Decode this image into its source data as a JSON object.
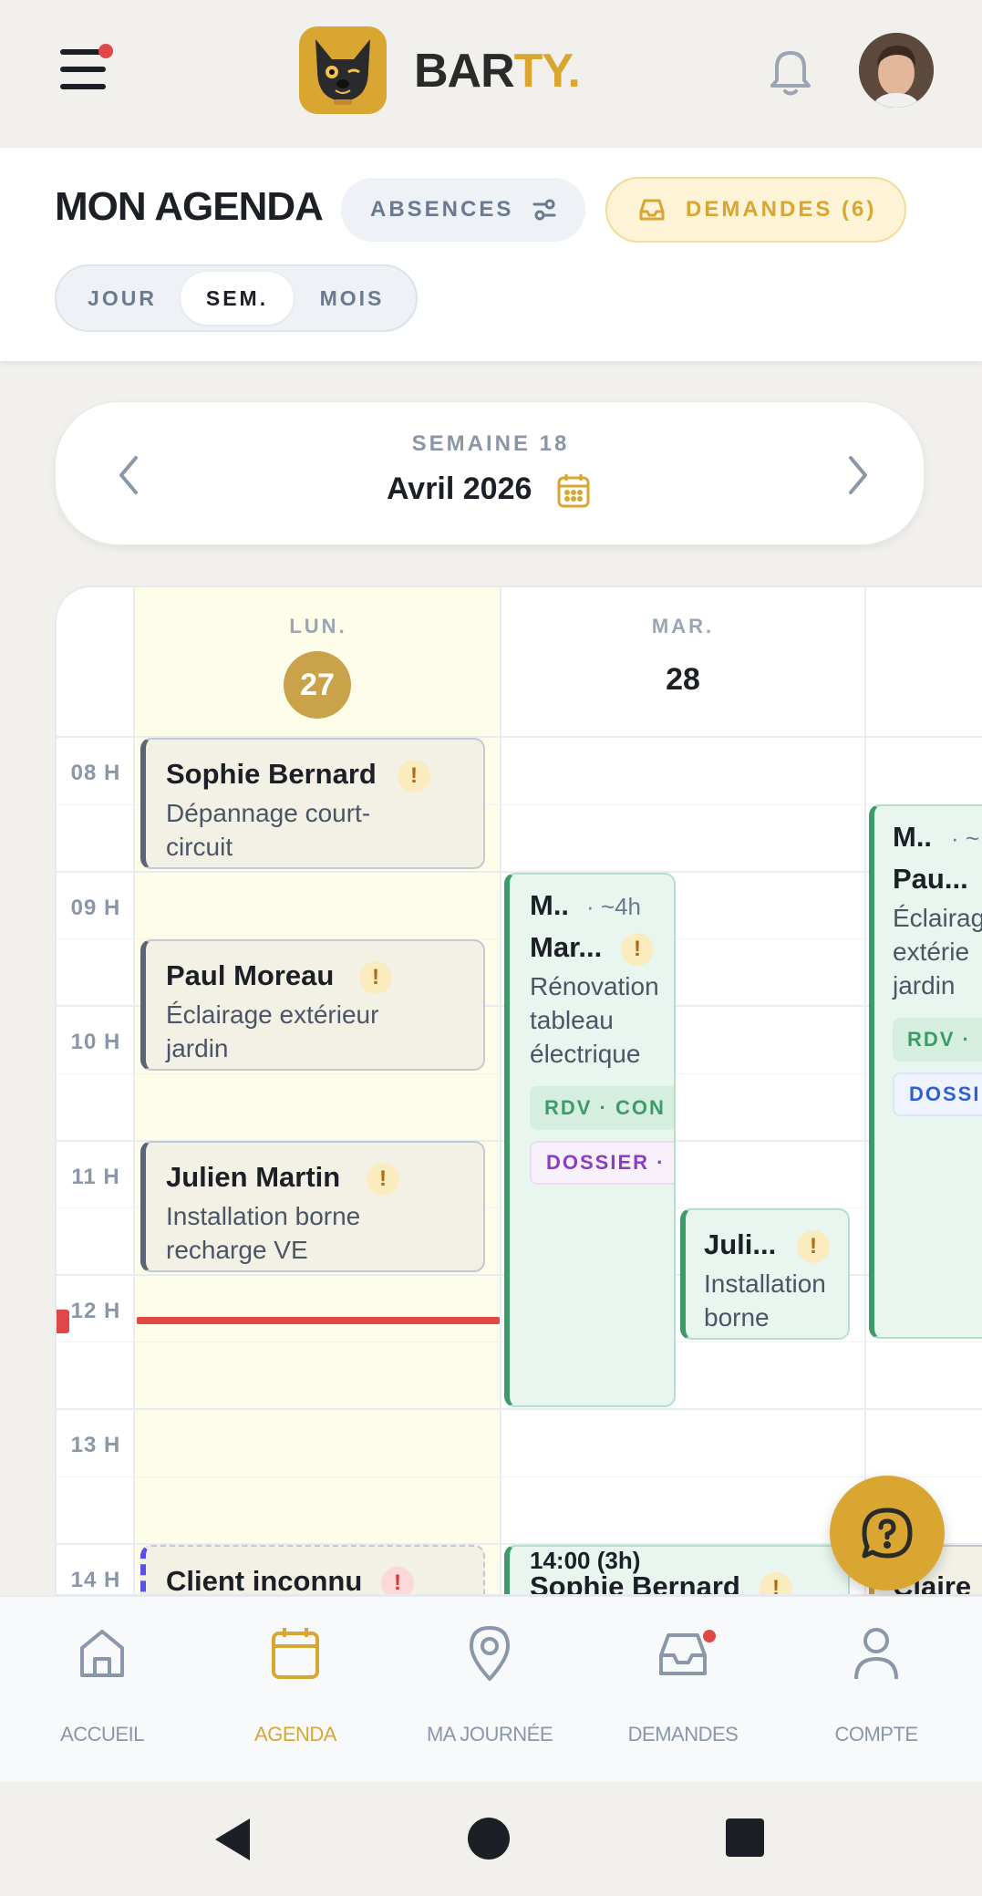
{
  "app": {
    "brand_main": "BAR",
    "brand_accent": "TY.",
    "colors": {
      "accent": "#d9a632",
      "today": "#c9a24a",
      "alert": "#e04848",
      "event_green": "#3c9b68"
    }
  },
  "header": {
    "title": "MON AGENDA",
    "absences_label": "ABSENCES",
    "demandes_label": "DEMANDES (6)",
    "views": [
      "JOUR",
      "SEM.",
      "MOIS"
    ],
    "active_view": "SEM."
  },
  "week_nav": {
    "week_label": "SEMAINE 18",
    "month_label": "Avril 2026"
  },
  "calendar": {
    "hours": [
      "08 H",
      "09 H",
      "10 H",
      "11 H",
      "12 H",
      "13 H",
      "14 H"
    ],
    "days": [
      {
        "name": "LUN.",
        "number": "27",
        "today": true
      },
      {
        "name": "MAR.",
        "number": "28",
        "today": false
      }
    ],
    "events": {
      "mon_1": {
        "title": "Sophie Bernard",
        "line1": "Dépannage court-",
        "line2": "circuit",
        "flag": "!"
      },
      "mon_2": {
        "title": "Paul Moreau",
        "line1": "Éclairage extérieur",
        "line2": "jardin",
        "flag": "!"
      },
      "mon_3": {
        "title": "Julien Martin",
        "line1": "Installation borne",
        "line2": "recharge VE",
        "flag": "!"
      },
      "mon_4": {
        "title": "Client inconnu",
        "flag": "!"
      },
      "tue_1": {
        "meta_a": "M..",
        "meta_b": "· ~4h",
        "title": "Mar...",
        "line1": "Rénovation",
        "line2": "tableau",
        "line3": "électrique",
        "tag1": "RDV · CON",
        "tag2": "DOSSIER ·",
        "flag": "!"
      },
      "tue_2": {
        "title": "Juli...",
        "line1": "Installation",
        "line2": "borne",
        "flag": "!"
      },
      "tue_3": {
        "meta": "14:00 (3h)",
        "title": "Sophie Bernard",
        "flag": "!"
      },
      "wed_1": {
        "meta_a": "M..",
        "meta_b": "· ~",
        "title": "Pau...",
        "line1": "Éclairag",
        "line2": "extérie",
        "line3": "jardin",
        "tag1": "RDV ·",
        "tag2": "DOSSI"
      },
      "wed_2": {
        "title": "Claire"
      }
    }
  },
  "bottom_nav": {
    "items": [
      {
        "label": "ACCUEIL",
        "icon": "home-icon"
      },
      {
        "label": "AGENDA",
        "icon": "calendar-icon"
      },
      {
        "label": "MA JOURNÉE",
        "icon": "map-pin-icon"
      },
      {
        "label": "DEMANDES",
        "icon": "inbox-icon"
      },
      {
        "label": "COMPTE",
        "icon": "user-icon"
      }
    ],
    "active": "AGENDA"
  }
}
